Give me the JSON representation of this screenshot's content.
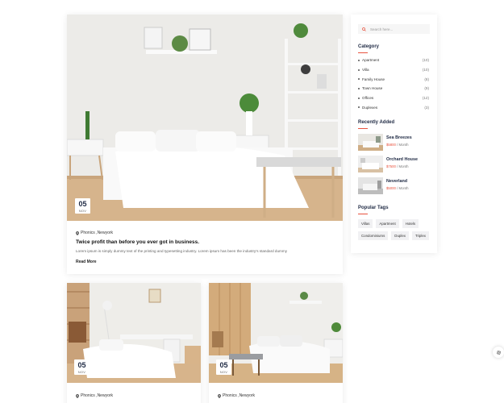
{
  "posts": [
    {
      "day": "05",
      "month": "NOV",
      "location": "Phonics ,Newyork",
      "title": "Twice profit than before you ever got in business.",
      "excerpt": "Lorem ipsum is simply dummy text of the printing and typesetting industry. Lorem ipsum has been the industry's standard dummy",
      "read_more": "Read More"
    },
    {
      "day": "05",
      "month": "NOV",
      "location": "Phonics ,Newyork"
    },
    {
      "day": "05",
      "month": "NOV",
      "location": "Phonics ,Newyork"
    }
  ],
  "sidebar": {
    "search_placeholder": "Search here...",
    "category_title": "Category",
    "categories": [
      {
        "name": "Apartment",
        "count": "(10)"
      },
      {
        "name": "Villa",
        "count": "(10)"
      },
      {
        "name": "Family House",
        "count": "(8)"
      },
      {
        "name": "Town House",
        "count": "(9)"
      },
      {
        "name": "Offices",
        "count": "(12)"
      },
      {
        "name": "Duplexes",
        "count": "(3)"
      }
    ],
    "recent_title": "Recently Added",
    "recent": [
      {
        "name": "Sea Breezes",
        "price": "$5800",
        "period": " / Month"
      },
      {
        "name": "Orchard House",
        "price": "$7500",
        "period": " / Month"
      },
      {
        "name": "Neverland",
        "price": "$5000",
        "period": " / Month"
      }
    ],
    "tags_title": "Popular Tags",
    "tags": [
      "Villas",
      "Apartment",
      "Hotels",
      "Condominiums",
      "Duplex",
      "Triplex"
    ]
  },
  "icons": {
    "search": "search-icon",
    "location": "map-pin-icon",
    "settings": "gear-icon"
  },
  "colors": {
    "accent": "#e8533f",
    "heading": "#1f2a44"
  }
}
